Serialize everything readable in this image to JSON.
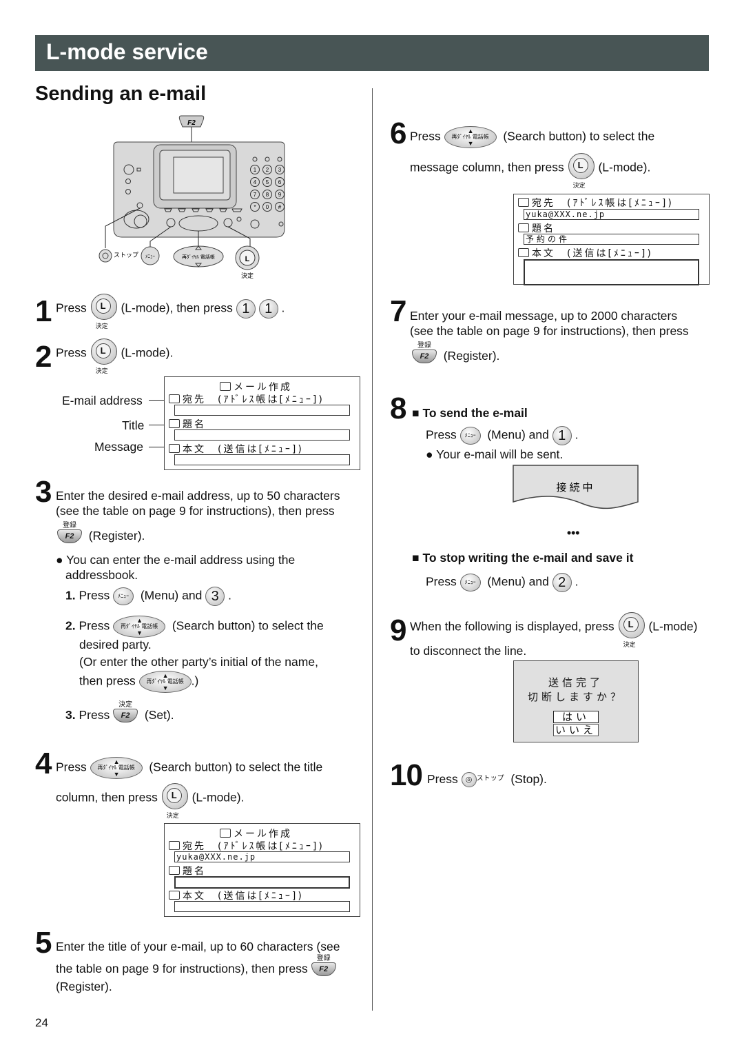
{
  "header": {
    "banner_title": "L-mode service",
    "section_title": "Sending an e-mail"
  },
  "page_number": "24",
  "icons": {
    "lmode": "lmode-button-icon",
    "lmode_caption": "決定",
    "f2_label": "F2",
    "f2_register_caption": "登録",
    "f2_set_caption": "決定",
    "menu_label": "ﾒﾆｭｰ",
    "search_label": "再ﾀﾞｲﾔﾙ 電話帳",
    "stop_caption": "ストップ"
  },
  "diagram": {
    "f2_label": "F2",
    "stop_label": "ストップ",
    "menu_label": "ﾒﾆｭｰ",
    "search_label": "再ﾀﾞｲﾔﾙ 電話帳",
    "lmode_caption": "決定",
    "keypad": [
      "1",
      "2",
      "3",
      "4",
      "5",
      "6",
      "7",
      "8",
      "9",
      "*",
      "0",
      "#"
    ]
  },
  "steps": {
    "s1": {
      "num": "1",
      "press": "Press",
      "mid": "(L-mode), then press",
      "key1": "1",
      "key2": "1",
      "end": "."
    },
    "s2": {
      "num": "2",
      "press": "Press",
      "end": "(L-mode)."
    },
    "s3": {
      "num": "3",
      "line1": "Enter the desired e-mail address, up to 50 characters",
      "line2": "(see the table on page 9 for instructions), then press",
      "register": "(Register).",
      "bullet_l1": "You can enter the e-mail address using the",
      "bullet_l2": "addressbook.",
      "sub1_num": "1.",
      "sub1_press": "Press",
      "sub1_mid": "(Menu) and",
      "sub1_key": "3",
      "sub1_end": ".",
      "sub2_num": "2.",
      "sub2_press": "Press",
      "sub2_mid": "(Search button) to select the",
      "sub2_l2": "desired party.",
      "sub2_l3": "(Or enter the other party’s initial of the name,",
      "sub2_l4a": "then press",
      "sub2_l4b": ".)",
      "sub3_num": "3.",
      "sub3_press": "Press",
      "sub3_end": "(Set)."
    },
    "s4": {
      "num": "4",
      "press": "Press",
      "mid": "(Search button) to select the title",
      "l2": "column, then press",
      "end": "(L-mode)."
    },
    "s5": {
      "num": "5",
      "l1": "Enter the title of your e-mail, up to 60 characters (see",
      "l2": "the table on page 9 for instructions), then press",
      "l3": "(Register)."
    },
    "s6": {
      "num": "6",
      "press": "Press",
      "mid": "(Search button) to select the",
      "l2": "message column, then press",
      "end": "(L-mode)."
    },
    "s7": {
      "num": "7",
      "l1": "Enter your e-mail message, up to 2000 characters",
      "l2": "(see the table on page 9 for instructions), then press",
      "register": "(Register)."
    },
    "s8": {
      "num": "8",
      "heading_send": "To send the e-mail",
      "press": "Press",
      "mid": "(Menu) and",
      "key": "1",
      "end": ".",
      "bullet": "Your e-mail will be sent.",
      "ellipsis": "•••",
      "heading_stop": "To stop writing the e-mail and save it",
      "stop_press": "Press",
      "stop_mid": "(Menu) and",
      "stop_key": "2",
      "stop_end": "."
    },
    "s9": {
      "num": "9",
      "l1": "When the following is displayed, press",
      "end": "(L-mode)",
      "l2": "to disconnect the line."
    },
    "s10": {
      "num": "10",
      "press": "Press",
      "end": "(Stop)."
    }
  },
  "lcd_compose": {
    "title": "メール作成",
    "to_label": "宛先　(ｱﾄﾞﾚｽ帳は[ﾒﾆｭｰ])",
    "subject_label": "題名",
    "body_label": "本文　(送信は[ﾒﾆｭｰ])",
    "callouts": {
      "email": "E-mail address",
      "title": "Title",
      "message": "Message"
    }
  },
  "lcd_step4": {
    "title": "メール作成",
    "to_label": "宛先　(ｱﾄﾞﾚｽ帳は[ﾒﾆｭｰ])",
    "to_value": "yuka@XXX.ne.jp",
    "subject_label": "題名",
    "subject_value": "",
    "body_label": "本文　(送信は[ﾒﾆｭｰ])"
  },
  "lcd_step6": {
    "to_label": "宛先　(ｱﾄﾞﾚｽ帳は[ﾒﾆｭｰ])",
    "to_value": "yuka@XXX.ne.jp",
    "subject_label": "題名",
    "subject_value": "予約の件",
    "body_label": "本文　(送信は[ﾒﾆｭｰ])"
  },
  "lcd_connecting": {
    "text": "接続中"
  },
  "lcd_disconnect": {
    "line1": "送信完了",
    "line2": "切断しますか？",
    "yes": "はい",
    "no": "いいえ"
  }
}
